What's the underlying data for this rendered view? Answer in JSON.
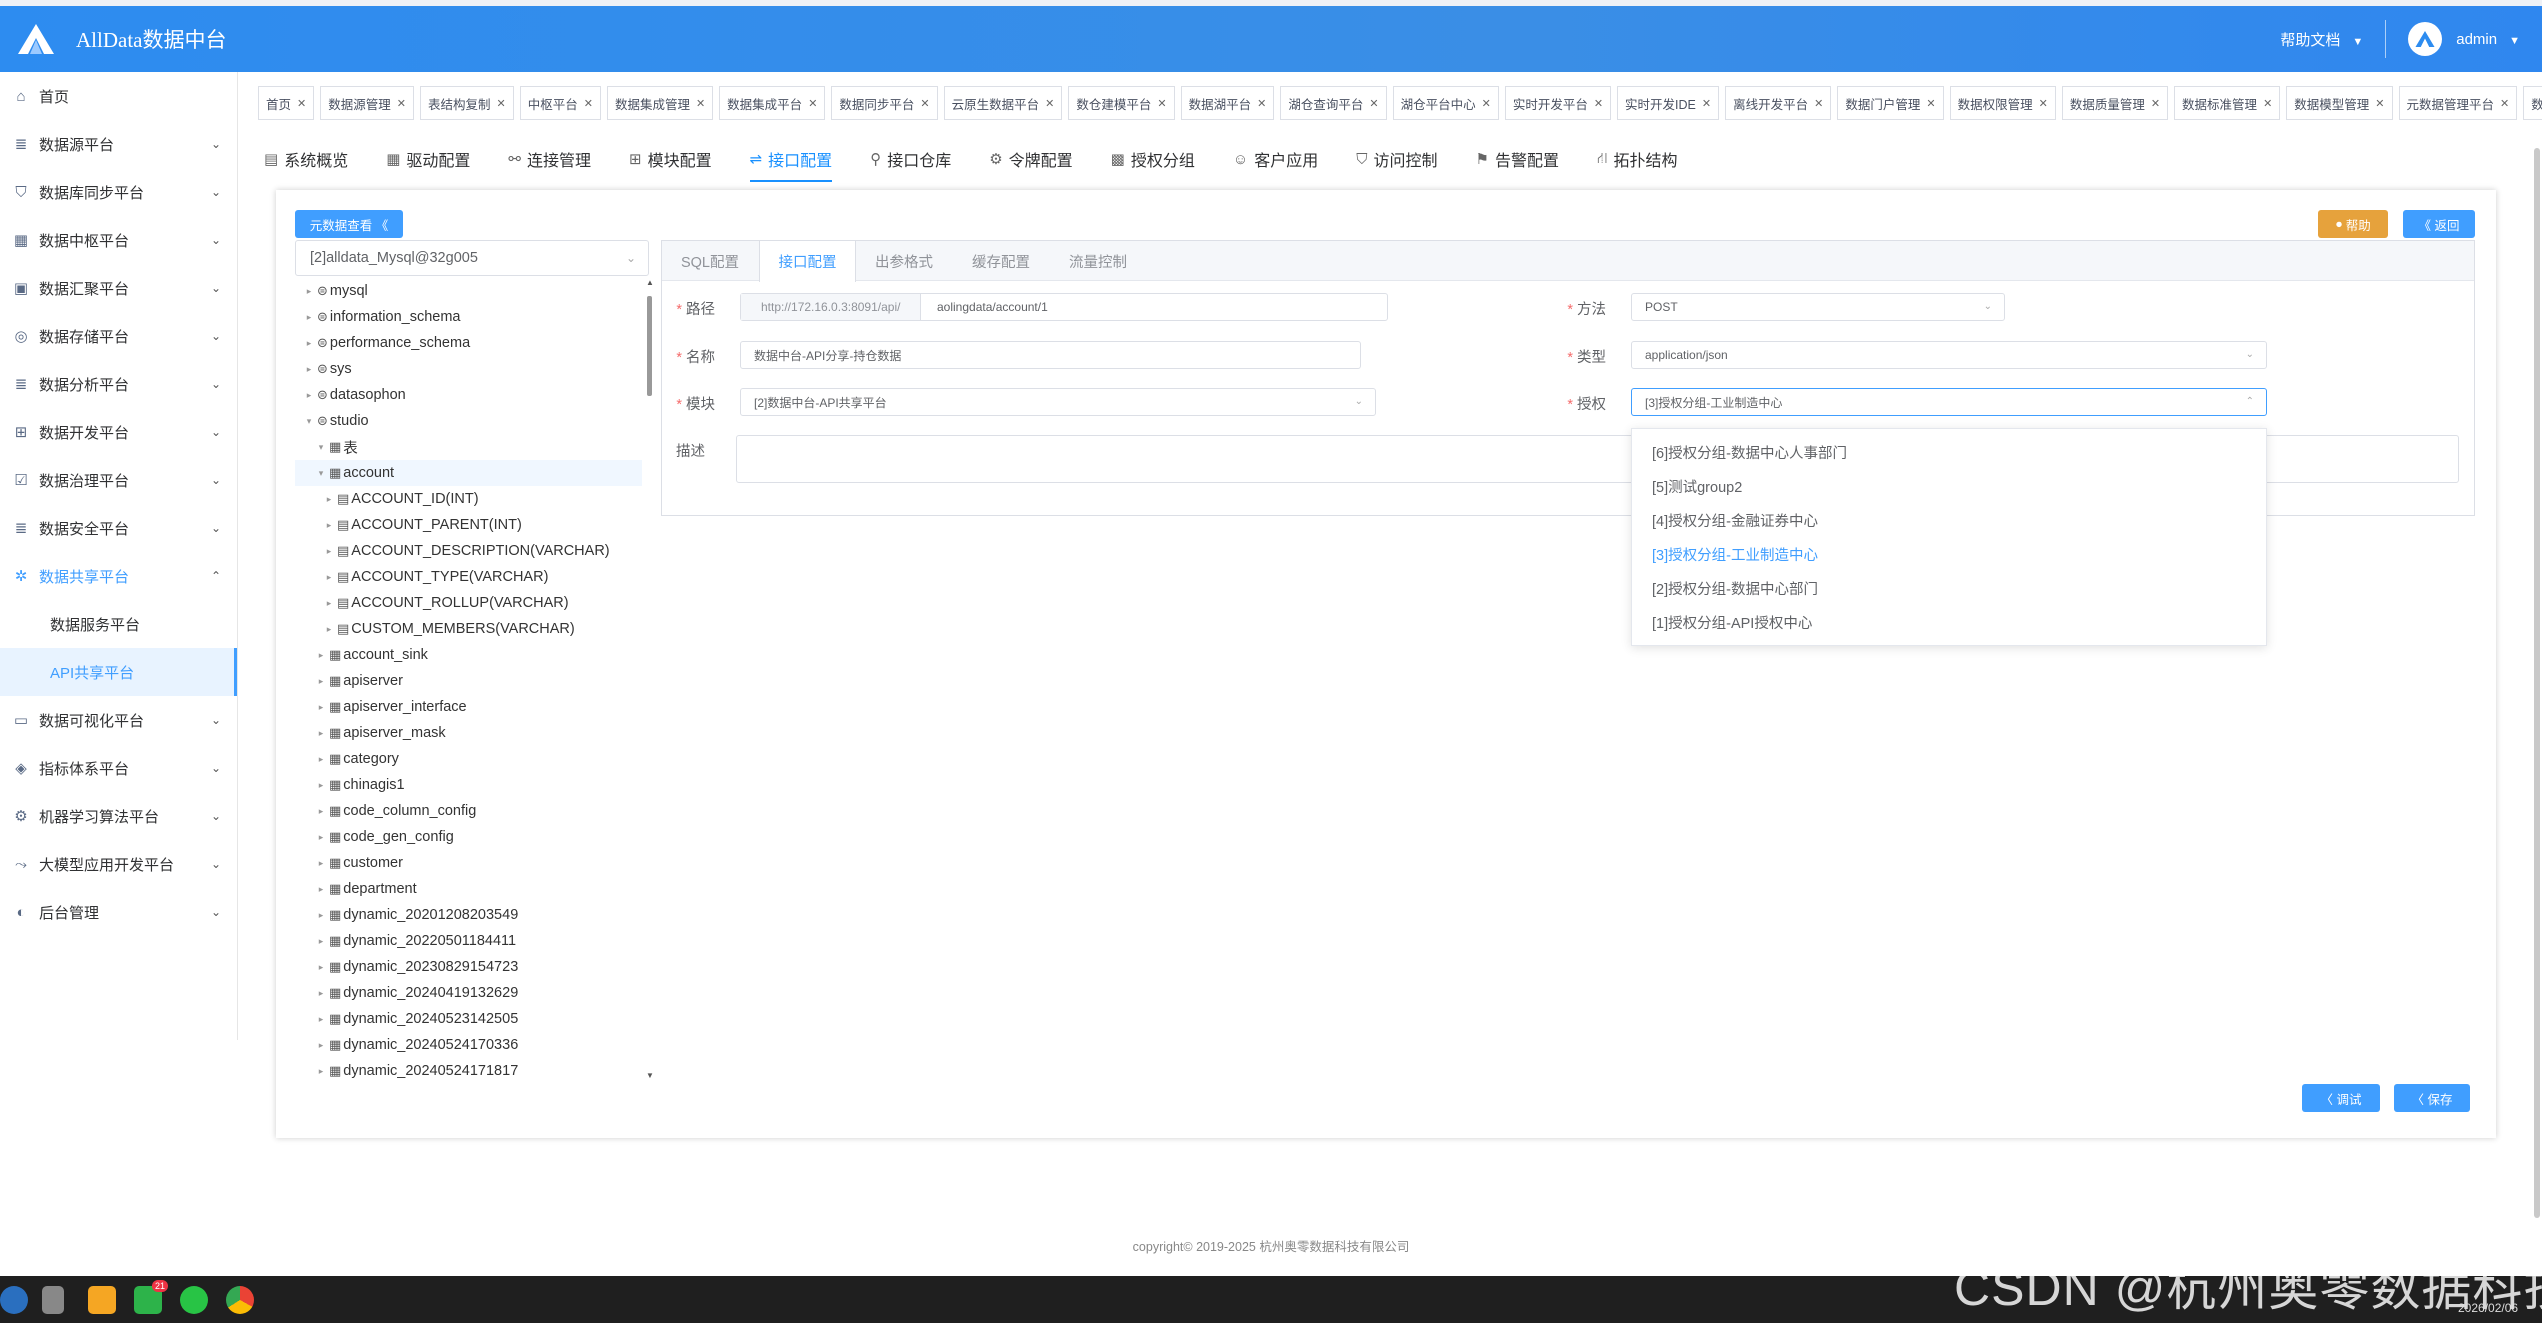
{
  "app": {
    "title": "AllData数据中台",
    "help": "帮助文档",
    "user": "admin"
  },
  "sidebar": {
    "items": [
      {
        "label": "首页"
      },
      {
        "label": "数据源平台"
      },
      {
        "label": "数据库同步平台"
      },
      {
        "label": "数据中枢平台"
      },
      {
        "label": "数据汇聚平台"
      },
      {
        "label": "数据存储平台"
      },
      {
        "label": "数据分析平台"
      },
      {
        "label": "数据开发平台"
      },
      {
        "label": "数据治理平台"
      },
      {
        "label": "数据安全平台"
      },
      {
        "label": "数据共享平台"
      },
      {
        "label": "数据可视化平台"
      },
      {
        "label": "指标体系平台"
      },
      {
        "label": "机器学习算法平台"
      },
      {
        "label": "大模型应用开发平台"
      },
      {
        "label": "后台管理"
      }
    ],
    "sub_items": [
      {
        "label": "数据服务平台"
      },
      {
        "label": "API共享平台"
      }
    ]
  },
  "tags": [
    "首页",
    "数据源管理",
    "表结构复制",
    "中枢平台",
    "数据集成管理",
    "数据集成平台",
    "数据同步平台",
    "云原生数据平台",
    "数仓建模平台",
    "数据湖平台",
    "湖仓查询平台",
    "湖仓平台中心",
    "实时开发平台",
    "实时开发IDE",
    "离线开发平台",
    "数据门户管理",
    "数据权限管理",
    "数据质量管理",
    "数据标准管理",
    "数据模型管理",
    "元数据管理平台",
    "数据质"
  ],
  "nav_tabs": [
    "系统概览",
    "驱动配置",
    "连接管理",
    "模块配置",
    "接口配置",
    "接口仓库",
    "令牌配置",
    "授权分组",
    "客户应用",
    "访问控制",
    "告警配置",
    "拓扑结构"
  ],
  "buttons": {
    "metadata": "元数据查看 《",
    "help": "帮助",
    "back": "《 返回",
    "debug": "〈 调试",
    "save": "〈 保存"
  },
  "db_select": "[2]alldata_Mysql@32g005",
  "tree": {
    "nodes": [
      "mysql",
      "information_schema",
      "performance_schema",
      "sys",
      "datasophon",
      "studio",
      "表",
      "account",
      "ACCOUNT_ID(INT)",
      "ACCOUNT_PARENT(INT)",
      "ACCOUNT_DESCRIPTION(VARCHAR)",
      "ACCOUNT_TYPE(VARCHAR)",
      "ACCOUNT_ROLLUP(VARCHAR)",
      "CUSTOM_MEMBERS(VARCHAR)",
      "account_sink",
      "apiserver",
      "apiserver_interface",
      "apiserver_mask",
      "category",
      "chinagis1",
      "code_column_config",
      "code_gen_config",
      "customer",
      "department",
      "dynamic_20201208203549",
      "dynamic_20220501184411",
      "dynamic_20230829154723",
      "dynamic_20240419132629",
      "dynamic_20240523142505",
      "dynamic_20240524170336",
      "dynamic_20240524171817"
    ]
  },
  "form_tabs": [
    "SQL配置",
    "接口配置",
    "出参格式",
    "缓存配置",
    "流量控制"
  ],
  "form": {
    "path_label": "路径",
    "path_prefix": "http://172.16.0.3:8091/api/",
    "path_value": "aolingdata/account/1",
    "method_label": "方法",
    "method_value": "POST",
    "name_label": "名称",
    "name_value": "数据中台-API分享-持仓数据",
    "type_label": "类型",
    "type_value": "application/json",
    "module_label": "模块",
    "module_value": "[2]数据中台-API共享平台",
    "auth_label": "授权",
    "auth_value": "[3]授权分组-工业制造中心",
    "desc_label": "描述"
  },
  "auth_options": [
    "[6]授权分组-数据中心人事部门",
    "[5]测试group2",
    "[4]授权分组-金融证券中心",
    "[3]授权分组-工业制造中心",
    "[2]授权分组-数据中心部门",
    "[1]授权分组-API授权中心"
  ],
  "footer": "copyright© 2019-2025 杭州奥零数据科技有限公司",
  "taskbar": {
    "watermark": "CSDN @杭州奥零数据科技",
    "date": "2026/02/06",
    "badge": "21"
  },
  "colors": {
    "primary": "#409eff",
    "topbar": "#3a8ee6",
    "help_button": "#e6a23c",
    "required": "#f56c6c"
  }
}
